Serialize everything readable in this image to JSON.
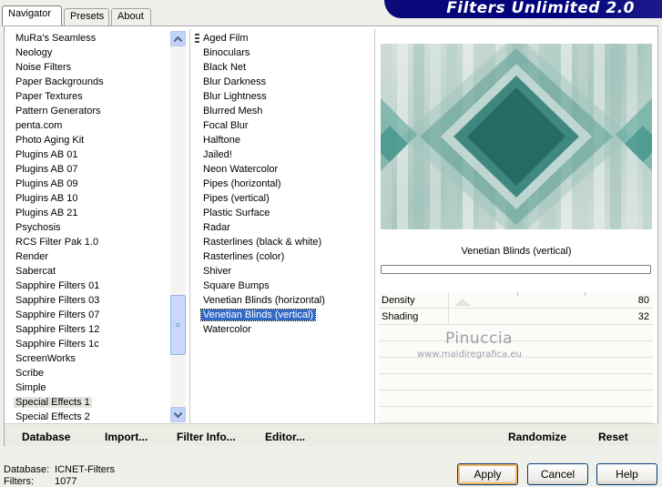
{
  "tabs": [
    {
      "label": "Navigator",
      "active": true
    },
    {
      "label": "Presets",
      "active": false
    },
    {
      "label": "About",
      "active": false
    }
  ],
  "banner_title": "Filters Unlimited 2.0",
  "categories": [
    "MuRa's Seamless",
    "Neology",
    "Noise Filters",
    "Paper Backgrounds",
    "Paper Textures",
    "Pattern Generators",
    "penta.com",
    "Photo Aging Kit",
    "Plugins AB 01",
    "Plugins AB 07",
    "Plugins AB 09",
    "Plugins AB 10",
    "Plugins AB 21",
    "Psychosis",
    "RCS Filter Pak 1.0",
    "Render",
    "Sabercat",
    "Sapphire Filters 01",
    "Sapphire Filters 03",
    "Sapphire Filters 07",
    "Sapphire Filters 12",
    "Sapphire Filters 1c",
    "ScreenWorks",
    "Scribe",
    "Simple",
    "Special Effects 1",
    "Special Effects 2"
  ],
  "selected_category": "Special Effects 1",
  "filters": [
    "Aged Film",
    "Binoculars",
    "Black Net",
    "Blur Darkness",
    "Blur Lightness",
    "Blurred Mesh",
    "Focal Blur",
    "Halftone",
    "Jailed!",
    "Neon Watercolor",
    "Pipes (horizontal)",
    "Pipes (vertical)",
    "Plastic Surface",
    "Radar",
    "Rasterlines (black & white)",
    "Rasterlines (color)",
    "Shiver",
    "Square Bumps",
    "Venetian Blinds (horizontal)",
    "Venetian Blinds (vertical)",
    "Watercolor"
  ],
  "selected_filter": "Venetian Blinds (vertical)",
  "preview": {
    "filter_name": "Venetian Blinds (vertical)",
    "progress": 0
  },
  "params": [
    {
      "label": "Density",
      "value": "80"
    },
    {
      "label": "Shading",
      "value": "32"
    }
  ],
  "watermark": {
    "line1": "Pinuccia",
    "line2": "www.maidiregrafica.eu"
  },
  "bottom_buttons": {
    "database": "Database",
    "import": "Import...",
    "filter_info": "Filter Info...",
    "editor": "Editor...",
    "randomize": "Randomize",
    "reset": "Reset"
  },
  "status": {
    "database_label": "Database:",
    "database_value": "ICNET-Filters",
    "filters_label": "Filters:",
    "filters_value": "1077"
  },
  "dialog_buttons": {
    "apply": "Apply",
    "cancel": "Cancel",
    "help": "Help"
  },
  "colors": {
    "accent": "#316ac5",
    "banner": "#00007b",
    "teal": "#2f7f79"
  }
}
